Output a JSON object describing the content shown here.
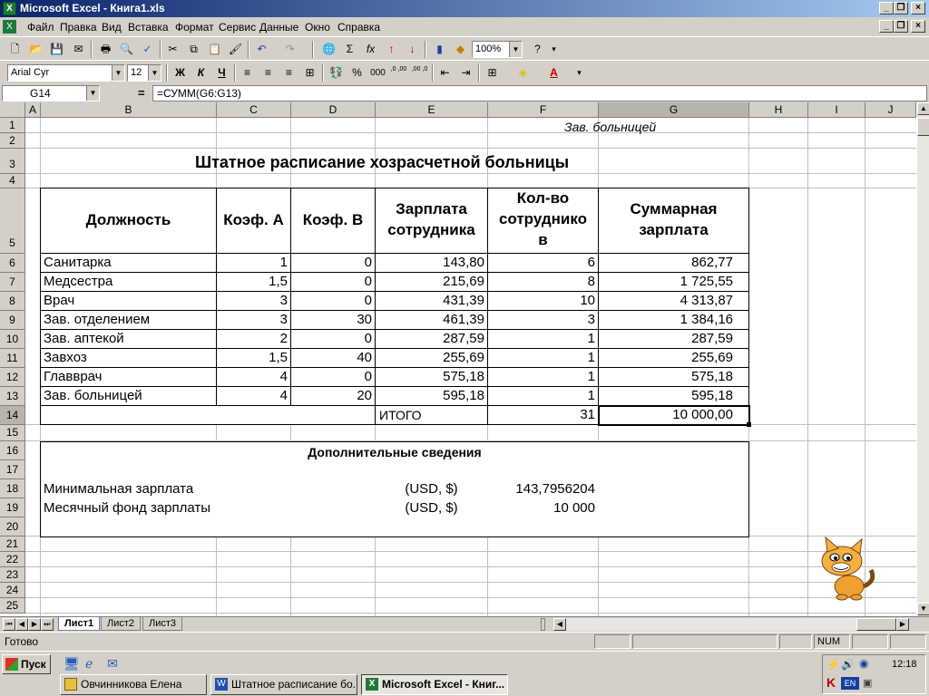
{
  "window": {
    "title": "Microsoft Excel - Книга1.xls"
  },
  "menu": [
    "Файл",
    "Правка",
    "Вид",
    "Вставка",
    "Формат",
    "Сервис",
    "Данные",
    "Окно",
    "Справка"
  ],
  "toolbar": {
    "zoom": "100%",
    "font": "Arial Cyr",
    "font_size": "12",
    "bold": "Ж",
    "italic": "К",
    "underline": "Ч",
    "sum": "Σ",
    "fx": "fx",
    "percent": "%",
    "thousands": "000",
    "decimal_inc": ",0 ,00",
    "decimal_dec": ",00 ,0"
  },
  "formula_bar": {
    "cell_ref": "G14",
    "formula": "=СУММ(G6:G13)"
  },
  "columns": [
    "A",
    "B",
    "C",
    "D",
    "E",
    "F",
    "G",
    "H",
    "I",
    "J"
  ],
  "rows": [
    "1",
    "2",
    "3",
    "4",
    "5",
    "6",
    "7",
    "8",
    "9",
    "10",
    "11",
    "12",
    "13",
    "14",
    "15",
    "16",
    "17",
    "18",
    "19",
    "20",
    "21",
    "22",
    "23",
    "24",
    "25"
  ],
  "sheet": {
    "header_note": "Зав. больницей",
    "title": "Штатное расписание хозрасчетной больницы",
    "table_headers": {
      "position": "Должность",
      "coef_a": "Коэф. А",
      "coef_b": "Коэф. В",
      "salary_line1": "Зарплата",
      "salary_line2": "сотрудника",
      "count_line1": "Кол-во",
      "count_line2": "сотруднико",
      "count_line3": "в",
      "total_line1": "Суммарная",
      "total_line2": "зарплата"
    },
    "table_rows": [
      {
        "position": "Санитарка",
        "a": "1",
        "b": "0",
        "salary": "143,80",
        "count": "6",
        "total": "862,77"
      },
      {
        "position": "Медсестра",
        "a": "1,5",
        "b": "0",
        "salary": "215,69",
        "count": "8",
        "total": "1 725,55"
      },
      {
        "position": "Врач",
        "a": "3",
        "b": "0",
        "salary": "431,39",
        "count": "10",
        "total": "4 313,87"
      },
      {
        "position": "Зав. отделением",
        "a": "3",
        "b": "30",
        "salary": "461,39",
        "count": "3",
        "total": "1 384,16"
      },
      {
        "position": "Зав. аптекой",
        "a": "2",
        "b": "0",
        "salary": "287,59",
        "count": "1",
        "total": "287,59"
      },
      {
        "position": "Завхоз",
        "a": "1,5",
        "b": "40",
        "salary": "255,69",
        "count": "1",
        "total": "255,69"
      },
      {
        "position": "Главврач",
        "a": "4",
        "b": "0",
        "salary": "575,18",
        "count": "1",
        "total": "575,18"
      },
      {
        "position": "Зав. больницей",
        "a": "4",
        "b": "20",
        "salary": "595,18",
        "count": "1",
        "total": "595,18"
      }
    ],
    "totals": {
      "label": "ИТОГО",
      "count": "31",
      "total": "10 000,00"
    },
    "extra": {
      "heading": "Дополнительные сведения",
      "min_salary_label": "Минимальная зарплата",
      "min_salary_unit": "(USD, $)",
      "min_salary_value": "143,7956204",
      "fund_label": "Месячный фонд зарплаты",
      "fund_unit": "(USD, $)",
      "fund_value": "10 000"
    }
  },
  "tabs": [
    "Лист1",
    "Лист2",
    "Лист3"
  ],
  "status": {
    "ready": "Готово",
    "num": "NUM"
  },
  "taskbar": {
    "start": "Пуск",
    "buttons": [
      "Овчинникова Елена",
      "Штатное расписание бо...",
      "Microsoft Excel - Книг..."
    ],
    "clock": "12:18",
    "lang": "EN"
  }
}
